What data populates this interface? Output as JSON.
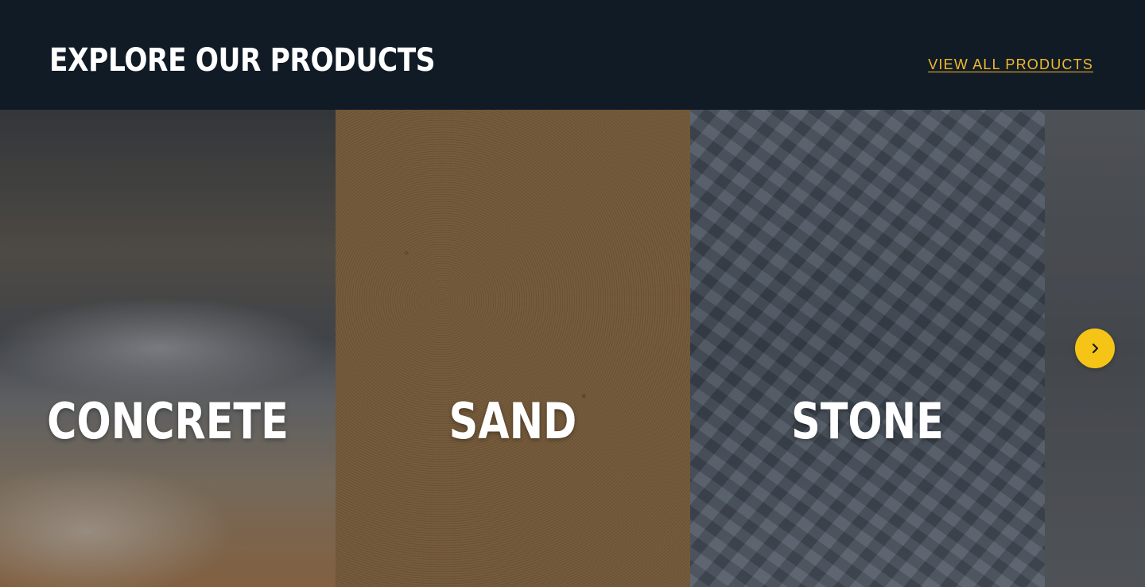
{
  "section": {
    "title": "EXPLORE OUR PRODUCTS",
    "view_all_label": "VIEW ALL PRODUCTS"
  },
  "products": [
    {
      "label": "CONCRETE"
    },
    {
      "label": "SAND"
    },
    {
      "label": "STONE"
    },
    {
      "label": ""
    }
  ],
  "carousel": {
    "next_icon": "chevron-right-icon"
  },
  "colors": {
    "background": "#111b26",
    "accent": "#f2b92e",
    "button": "#f6c416",
    "title_text": "#ffffff"
  }
}
